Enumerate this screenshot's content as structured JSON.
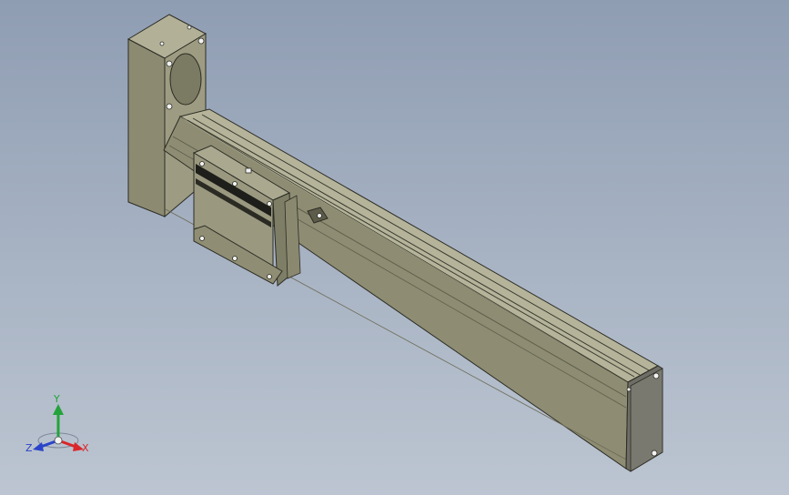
{
  "viewport": {
    "background_top": "#8f9db3",
    "background_bottom": "#bcc5d1"
  },
  "model": {
    "body_color": "#8e8d73",
    "body_dark": "#6f6e58",
    "body_light": "#a9a88c",
    "plate_color": "#76766b",
    "plate_dark": "#5a5a52"
  },
  "triad": {
    "x_label": "X",
    "y_label": "Y",
    "z_label": "Z",
    "x_color": "#d9262b",
    "y_color": "#23a33a",
    "z_color": "#2a44c9"
  }
}
